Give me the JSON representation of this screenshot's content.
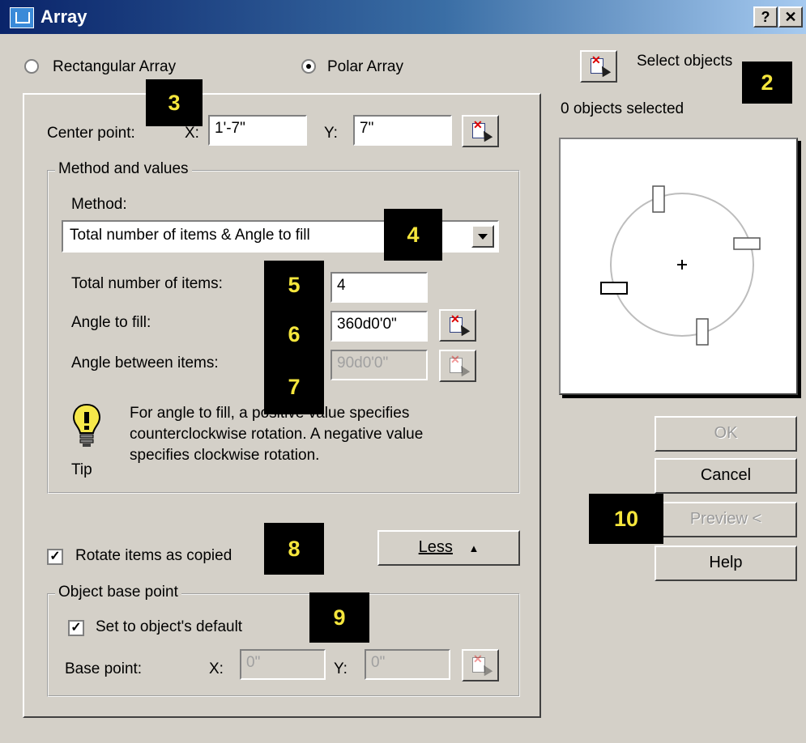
{
  "window": {
    "title": "Array",
    "help_label": "?",
    "close_label": "✕"
  },
  "array_type": {
    "rectangular_label": "Rectangular Array",
    "polar_label": "Polar Array",
    "selected": "Polar Array"
  },
  "selection": {
    "select_objects_label": "Select objects",
    "count_text": "0 objects selected"
  },
  "center_point": {
    "label": "Center point:",
    "x_label": "X:",
    "x_value": "1'-7\"",
    "y_label": "Y:",
    "y_value": "7\""
  },
  "method_values": {
    "group_title": "Method and values",
    "method_label": "Method:",
    "method_value": "Total number of items & Angle to fill",
    "total_items_label": "Total number of items:",
    "total_items_value": "4",
    "angle_fill_label": "Angle to fill:",
    "angle_fill_value": "360d0'0\"",
    "angle_between_label": "Angle between items:",
    "angle_between_value": "90d0'0\""
  },
  "tip": {
    "label": "Tip",
    "line1": "For angle to fill, a positive value specifies",
    "line2": "counterclockwise rotation.  A negative value",
    "line3": "specifies clockwise rotation."
  },
  "rotate_items": {
    "label": "Rotate items as copied",
    "checked": true
  },
  "less_button": {
    "label": "Less",
    "arrow": "▲"
  },
  "object_base_point": {
    "group_title": "Object base point",
    "default_label": "Set to object's default",
    "default_checked": true,
    "base_point_label": "Base point:",
    "x_label": "X:",
    "x_value": "0\"",
    "y_label": "Y:",
    "y_value": "0\""
  },
  "buttons": {
    "ok": "OK",
    "cancel": "Cancel",
    "preview": "Preview <",
    "help": "Help"
  },
  "badges": [
    "2",
    "3",
    "4",
    "5",
    "6",
    "7",
    "8",
    "9",
    "10"
  ],
  "check_mark": "✓",
  "colors": {
    "dialog_bg": "#d4d0c8",
    "title_start": "#0a246a",
    "title_end": "#a6caf0",
    "badge_bg": "#000000",
    "badge_text": "#f5e63c"
  }
}
